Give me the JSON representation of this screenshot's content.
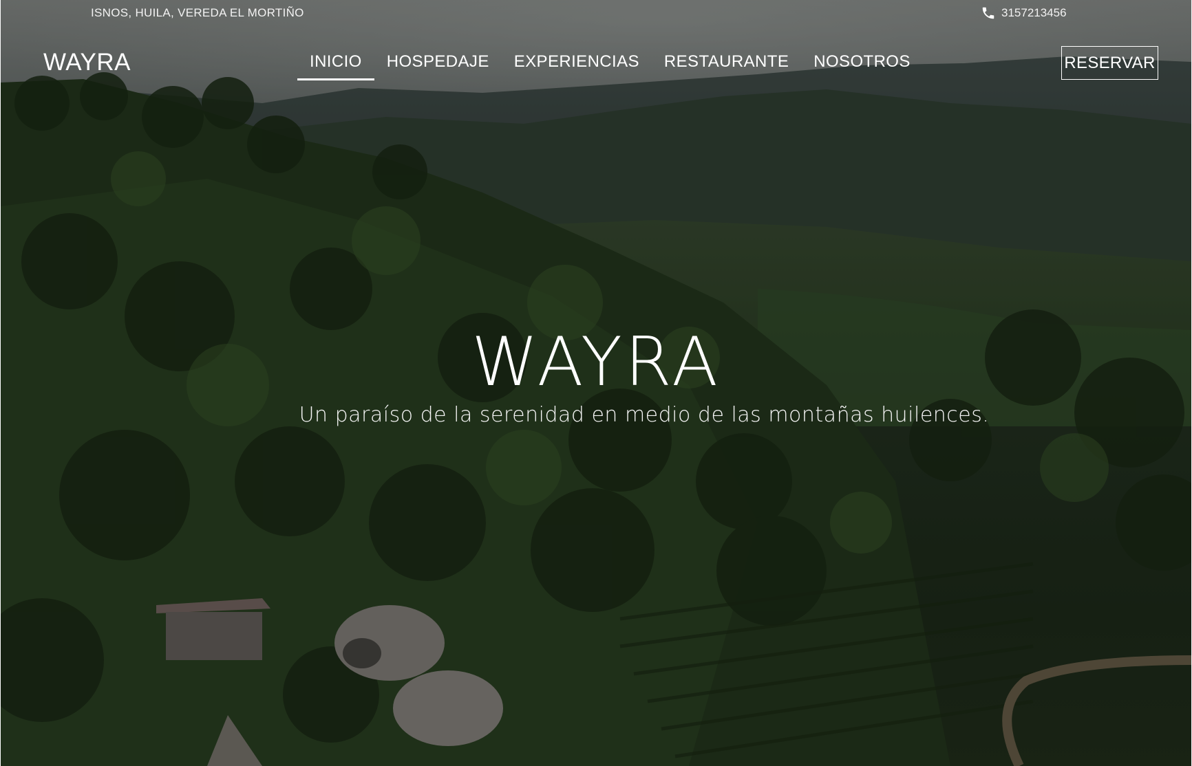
{
  "topbar": {
    "location": "ISNOS, HUILA, VEREDA EL MORTIÑO",
    "phone": "3157213456",
    "phone_icon": "phone-icon"
  },
  "header": {
    "brand": "WAYRA",
    "nav": [
      {
        "label": "INICIO",
        "active": true
      },
      {
        "label": "HOSPEDAJE",
        "active": false
      },
      {
        "label": "EXPERIENCIAS",
        "active": false
      },
      {
        "label": "RESTAURANTE",
        "active": false
      },
      {
        "label": "NOSOTROS",
        "active": false
      }
    ],
    "reserve_label": "RESERVAR"
  },
  "hero": {
    "title": "WAYRA",
    "subtitle": "Un paraíso de la serenidad en medio de las montañas huilences."
  },
  "colors": {
    "text": "#ffffff",
    "overlay": "rgba(0,0,0,0.28)"
  }
}
